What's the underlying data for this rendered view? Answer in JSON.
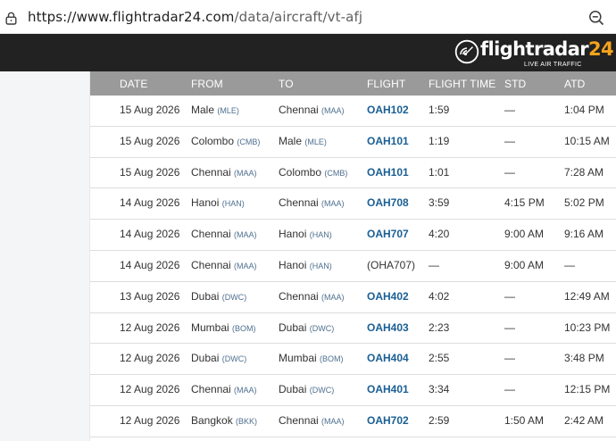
{
  "browser": {
    "url_host": "https://www.flightradar24.com",
    "url_path": "/data/aircraft/vt-afj"
  },
  "site": {
    "logo_word": "flightradar",
    "logo_num": "24",
    "tagline": "LIVE AIR TRAFFIC"
  },
  "table": {
    "headers": [
      "DATE",
      "FROM",
      "TO",
      "FLIGHT",
      "FLIGHT TIME",
      "STD",
      "ATD"
    ],
    "rows": [
      {
        "date": "15 Aug 2026",
        "from_city": "Male",
        "from_code": "(MLE)",
        "to_city": "Chennai",
        "to_code": "(MAA)",
        "flight": "OAH102",
        "flight_link": true,
        "flight_time": "1:59",
        "std": "—",
        "atd": "1:04 PM"
      },
      {
        "date": "15 Aug 2026",
        "from_city": "Colombo",
        "from_code": "(CMB)",
        "to_city": "Male",
        "to_code": "(MLE)",
        "flight": "OAH101",
        "flight_link": true,
        "flight_time": "1:19",
        "std": "—",
        "atd": "10:15 AM"
      },
      {
        "date": "15 Aug 2026",
        "from_city": "Chennai",
        "from_code": "(MAA)",
        "to_city": "Colombo",
        "to_code": "(CMB)",
        "flight": "OAH101",
        "flight_link": true,
        "flight_time": "1:01",
        "std": "—",
        "atd": "7:28 AM"
      },
      {
        "date": "14 Aug 2026",
        "from_city": "Hanoi",
        "from_code": "(HAN)",
        "to_city": "Chennai",
        "to_code": "(MAA)",
        "flight": "OAH708",
        "flight_link": true,
        "flight_time": "3:59",
        "std": "4:15 PM",
        "atd": "5:02 PM"
      },
      {
        "date": "14 Aug 2026",
        "from_city": "Chennai",
        "from_code": "(MAA)",
        "to_city": "Hanoi",
        "to_code": "(HAN)",
        "flight": "OAH707",
        "flight_link": true,
        "flight_time": "4:20",
        "std": "9:00 AM",
        "atd": "9:16 AM"
      },
      {
        "date": "14 Aug 2026",
        "from_city": "Chennai",
        "from_code": "(MAA)",
        "to_city": "Hanoi",
        "to_code": "(HAN)",
        "flight": "(OHA707)",
        "flight_link": false,
        "flight_time": "—",
        "std": "9:00 AM",
        "atd": "—"
      },
      {
        "date": "13 Aug 2026",
        "from_city": "Dubai",
        "from_code": "(DWC)",
        "to_city": "Chennai",
        "to_code": "(MAA)",
        "flight": "OAH402",
        "flight_link": true,
        "flight_time": "4:02",
        "std": "—",
        "atd": "12:49 AM"
      },
      {
        "date": "12 Aug 2026",
        "from_city": "Mumbai",
        "from_code": "(BOM)",
        "to_city": "Dubai",
        "to_code": "(DWC)",
        "flight": "OAH403",
        "flight_link": true,
        "flight_time": "2:23",
        "std": "—",
        "atd": "10:23 PM"
      },
      {
        "date": "12 Aug 2026",
        "from_city": "Dubai",
        "from_code": "(DWC)",
        "to_city": "Mumbai",
        "to_code": "(BOM)",
        "flight": "OAH404",
        "flight_link": true,
        "flight_time": "2:55",
        "std": "—",
        "atd": "3:48 PM"
      },
      {
        "date": "12 Aug 2026",
        "from_city": "Chennai",
        "from_code": "(MAA)",
        "to_city": "Dubai",
        "to_code": "(DWC)",
        "flight": "OAH401",
        "flight_link": true,
        "flight_time": "3:34",
        "std": "—",
        "atd": "12:15 PM"
      },
      {
        "date": "12 Aug 2026",
        "from_city": "Bangkok",
        "from_code": "(BKK)",
        "to_city": "Chennai",
        "to_code": "(MAA)",
        "flight": "OAH702",
        "flight_link": true,
        "flight_time": "2:59",
        "std": "1:50 AM",
        "atd": "2:42 AM"
      }
    ]
  },
  "colors": {
    "header_bg": "#222222",
    "table_head_bg": "#9a9a9a",
    "flight_link": "#1a5f94",
    "airport_code": "#4d6f8f",
    "logo_accent": "#f4a31c"
  },
  "icons": {
    "address_bar_left": "lock-icon",
    "address_bar_right": "zoom-out-icon",
    "logo": "radar-logo-icon"
  }
}
